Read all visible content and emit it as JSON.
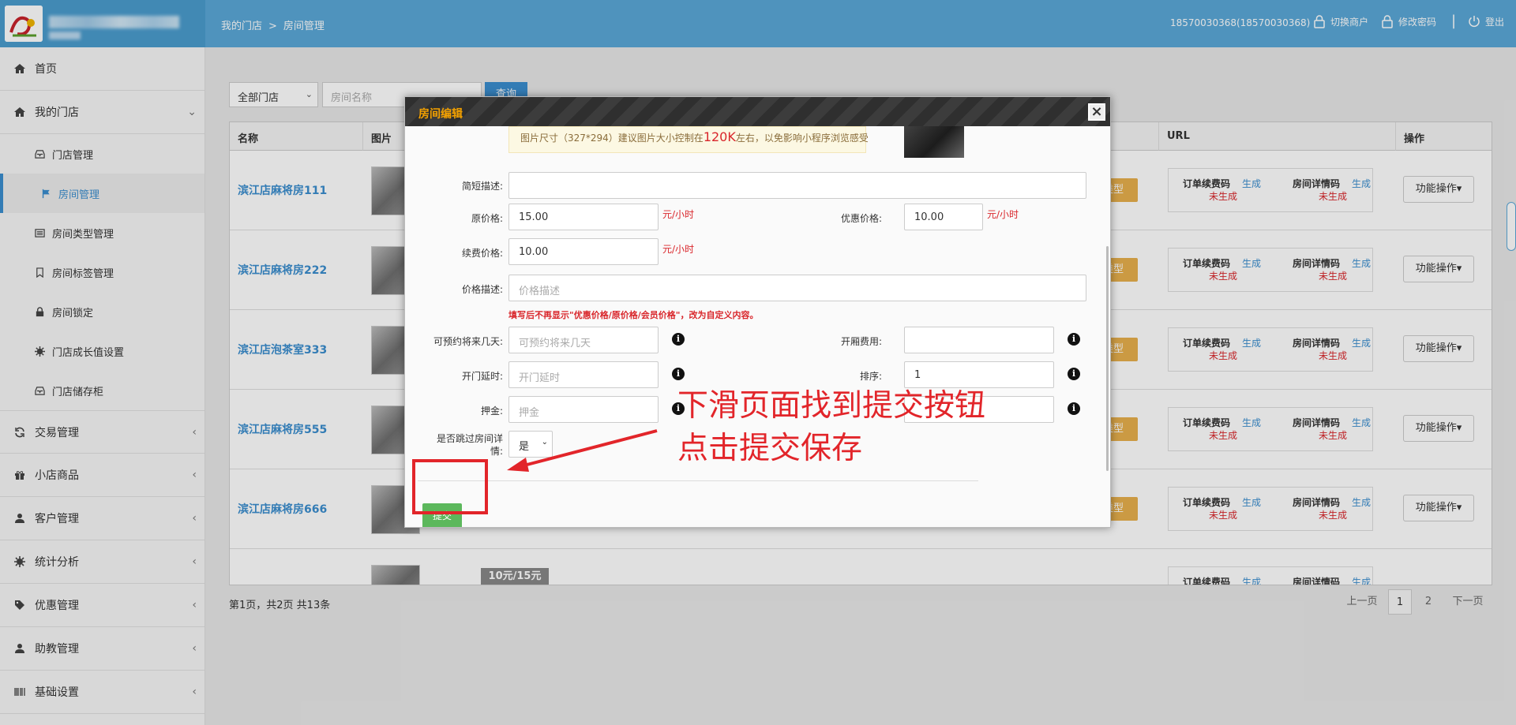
{
  "header": {
    "breadcrumb": [
      "我的门店",
      ">",
      "房间管理"
    ],
    "user": "18570030368(18570030368)",
    "switch_merchant": "切换商户",
    "change_password": "修改密码",
    "separator": "|",
    "logout": "登出"
  },
  "sidebar": {
    "home": "首页",
    "my_store": "我的门店",
    "sub_items": [
      "门店管理",
      "房间管理",
      "房间类型管理",
      "房间标签管理",
      "房间锁定",
      "门店成长值设置",
      "门店储存柜"
    ],
    "menus": [
      "交易管理",
      "小店商品",
      "客户管理",
      "统计分析",
      "优惠管理",
      "助教管理",
      "基础设置"
    ]
  },
  "filter": {
    "store_select": "全部门店",
    "room_name_placeholder": "房间名称",
    "query_button": "查询"
  },
  "table": {
    "headers": {
      "name": "名称",
      "image": "图片",
      "url": "URL",
      "ops": "操作"
    },
    "rows": [
      {
        "name": "滨江店麻将房111"
      },
      {
        "name": "滨江店麻将房222"
      },
      {
        "name": "滨江店泡茶室333"
      },
      {
        "name": "滨江店麻将房555"
      },
      {
        "name": "滨江店麻将房666"
      },
      {
        "name": ""
      }
    ],
    "type_chip": "类型",
    "price_badge": "10元/15元",
    "url_labels": {
      "order_code": "订单续费码",
      "room_code": "房间详情码",
      "generate": "生成",
      "not_generated": "未生成"
    },
    "action_button": "功能操作▾"
  },
  "pagination": {
    "info": "第1页，共2页 共13条",
    "prev": "上一页",
    "pages": [
      "1",
      "2"
    ],
    "next": "下一页"
  },
  "modal": {
    "title": "房间编辑",
    "close": "×",
    "tip_prefix": "图片尺寸（327*294）建议图片大小控制在",
    "tip_size": "120K",
    "tip_suffix": "左右，以免影响小程序浏览感受",
    "fields": {
      "short_desc_label": "简短描述:",
      "original_price_label": "原价格:",
      "original_price_value": "15.00",
      "discount_price_label": "优惠价格:",
      "discount_price_value": "10.00",
      "renew_price_label": "续费价格:",
      "renew_price_value": "10.00",
      "unit": "元/小时",
      "price_desc_label": "价格描述:",
      "price_desc_placeholder": "价格描述",
      "price_desc_help": "填写后不再显示\"优惠价格/原价格/会员价格\"，改为自定义内容。",
      "book_days_label": "可预约将来几天:",
      "book_days_placeholder": "可预约将来几天",
      "open_fee_label": "开厢费用:",
      "open_delay_label": "开门延时:",
      "open_delay_placeholder": "开门延时",
      "sort_label": "排序:",
      "sort_value": "1",
      "deposit_label": "押金:",
      "deposit_placeholder": "押金",
      "skip_detail_label_1": "是否跳过房间详",
      "skip_detail_label_2": "情:",
      "skip_detail_value": "是"
    },
    "submit": "提交"
  },
  "annotation": {
    "line1": "下滑页面找到提交按钮",
    "line2": "点击提交保存"
  },
  "colors": {
    "topbar": "#5ba8d8",
    "accent": "#3b8ecf",
    "danger": "#e2252a",
    "submit": "#5cb85c",
    "modal_title": "#f4a100"
  }
}
